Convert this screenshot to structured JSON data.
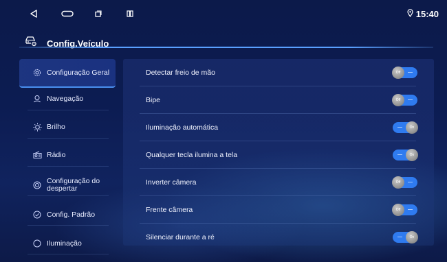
{
  "status_bar": {
    "back_icon": "back-triangle-icon",
    "home_icon": "home-pill-icon",
    "recents_icon": "recents-square-icon",
    "split_icon": "split-screen-icon",
    "location_icon": "location-pin-icon",
    "time": "15:40"
  },
  "header": {
    "icon": "car-settings-icon",
    "title": "Config.Veículo"
  },
  "sidebar": {
    "items": [
      {
        "label": "Configuração Geral",
        "icon": "gear-icon",
        "active": true
      },
      {
        "label": "Navegação",
        "icon": "navigation-icon",
        "active": false
      },
      {
        "label": "Brilho",
        "icon": "sun-icon",
        "active": false
      },
      {
        "label": "Rádio",
        "icon": "radio-icon",
        "active": false
      },
      {
        "label": "Configuração do despertar",
        "icon": "wake-icon",
        "active": false
      },
      {
        "label": "Config. Padrão",
        "icon": "check-circle-icon",
        "active": false
      },
      {
        "label": "Iluminação",
        "icon": "lighting-icon",
        "active": false
      }
    ]
  },
  "settings": [
    {
      "label": "Detectar freio de mão",
      "state": "off",
      "knob_text": "Off"
    },
    {
      "label": "Bipe",
      "state": "off",
      "knob_text": "Off"
    },
    {
      "label": "Iluminação automática",
      "state": "on",
      "knob_text": "On"
    },
    {
      "label": "Qualquer tecla ilumina a tela",
      "state": "on",
      "knob_text": "On"
    },
    {
      "label": "Inverter câmera",
      "state": "off",
      "knob_text": "Off"
    },
    {
      "label": "Frente câmera",
      "state": "off",
      "knob_text": "Off"
    },
    {
      "label": "Silenciar durante a ré",
      "state": "on",
      "knob_text": "On"
    }
  ],
  "colors": {
    "accent": "#2f7bf0",
    "background": "#0c1a4a",
    "knob": "#9a9a9a"
  }
}
